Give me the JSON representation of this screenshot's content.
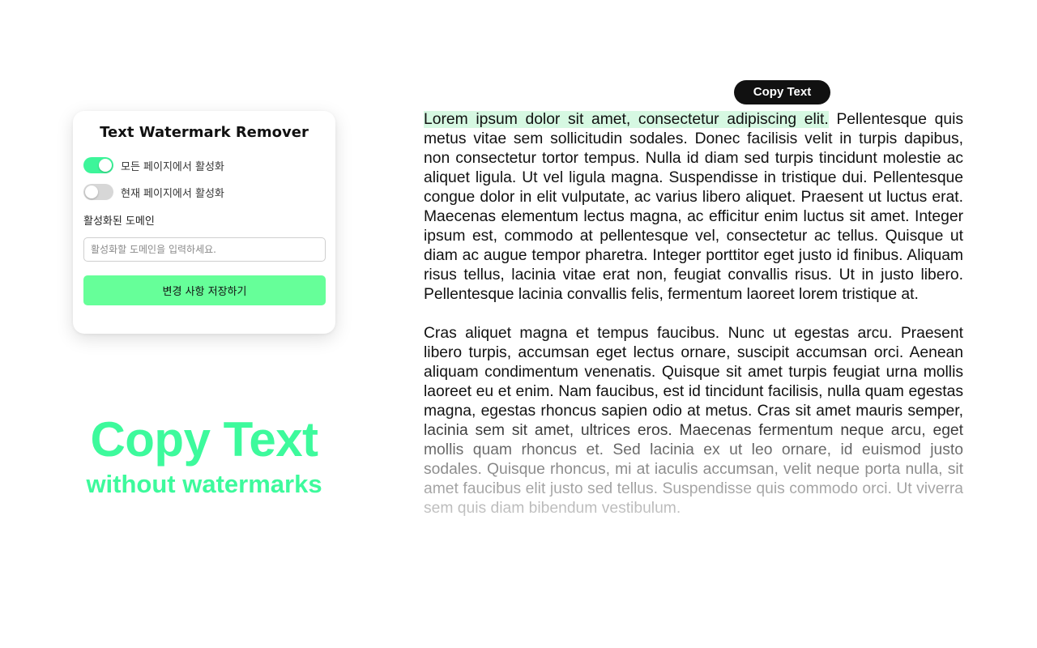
{
  "popup": {
    "title": "Text Watermark Remover",
    "toggle_all_pages": {
      "label": "모든 페이지에서 활성화",
      "enabled": true
    },
    "toggle_current_page": {
      "label": "현재 페이지에서 활성화",
      "enabled": false
    },
    "domains_label": "활성화된 도메인",
    "domain_input": {
      "value": "",
      "placeholder": "활성화할 도메인을 입력하세요."
    },
    "save_button": "변경 사항 저장하기"
  },
  "hero": {
    "title": "Copy Text",
    "subtitle": "without watermarks"
  },
  "copy_tooltip": "Copy Text",
  "article": {
    "highlighted": "Lorem ipsum dolor sit amet, consectetur adipiscing elit.",
    "paragraph1_rest": " Pellentesque quis metus vitae sem sollicitudin sodales. Donec facilisis velit in turpis dapibus, non consectetur tortor tempus. Nulla id diam sed turpis tincidunt molestie ac aliquet ligula. Ut vel ligula magna. Suspendisse in tristique dui. Pellentesque congue dolor in elit vulputate, ac varius libero aliquet. Praesent ut luctus erat. Maecenas elementum lectus magna, ac efficitur enim luctus sit amet. Integer ipsum est, commodo at pellentesque vel, consectetur ac tellus. Quisque ut diam ac augue tempor pharetra. Integer porttitor eget justo id finibus. Aliquam risus tellus, lacinia vitae erat non, feugiat convallis risus. Ut in justo libero. Pellentesque lacinia convallis felis, fermentum laoreet lorem tristique at.",
    "paragraph2": "Cras aliquet magna et tempus faucibus. Nunc ut egestas arcu. Praesent libero turpis, accumsan eget lectus ornare, suscipit accumsan orci. Aenean aliquam condimentum venenatis. Quisque sit amet turpis feugiat urna mollis laoreet eu et enim. Nam faucibus, est id tincidunt facilisis, nulla quam egestas magna, egestas rhoncus sapien odio at metus. Cras sit amet mauris semper, lacinia sem sit amet, ultrices eros. Maecenas fermentum neque arcu, eget mollis quam rhoncus et. Sed lacinia ex ut leo ornare, id euismod justo sodales. Quisque rhoncus, mi at iaculis accumsan, velit neque porta nulla, sit amet faucibus elit justo sed tellus. Suspendisse quis commodo orci. Ut viverra sem quis diam bibendum vestibulum."
  },
  "colors": {
    "accent_green": "#3dfa9c",
    "button_green": "#66ff99",
    "highlight": "#d6f8e2",
    "tooltip_bg": "#111111"
  }
}
